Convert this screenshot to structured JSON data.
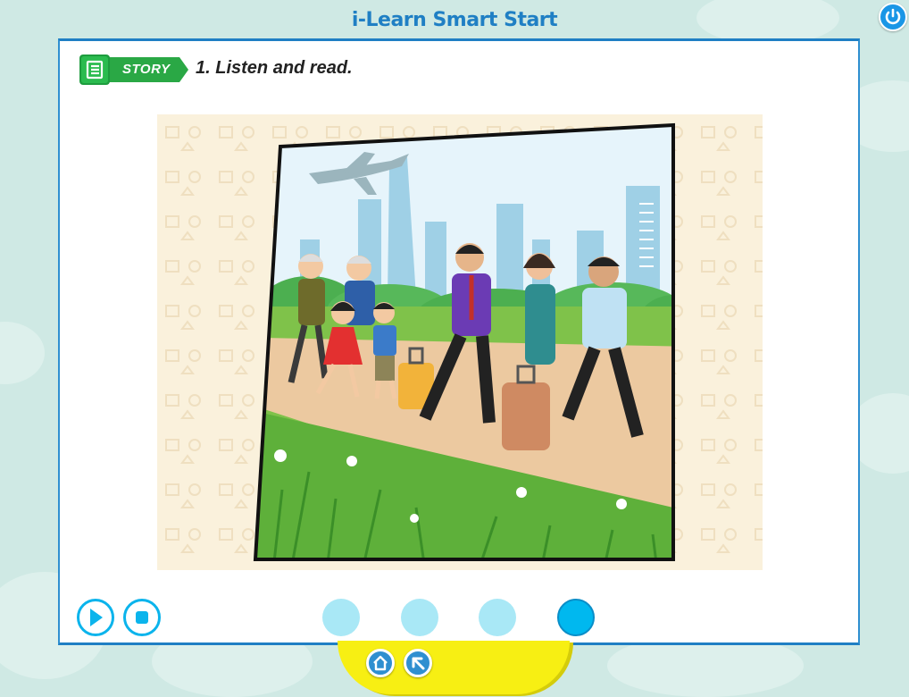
{
  "app": {
    "title": "i-Learn Smart Start"
  },
  "header": {
    "section_label": "STORY",
    "instruction": "1. Listen and read."
  },
  "icons": {
    "power": "power-icon",
    "story": "list-icon",
    "play": "play-icon",
    "stop": "stop-icon",
    "home": "home-icon",
    "back": "arrow-back-icon"
  },
  "pages": {
    "count": 4,
    "active_index": 3
  },
  "colors": {
    "accent": "#1f7fc4",
    "story_green": "#2aa845",
    "control_cyan": "#0bb4ec",
    "bottom_bar": "#f7ef13"
  }
}
